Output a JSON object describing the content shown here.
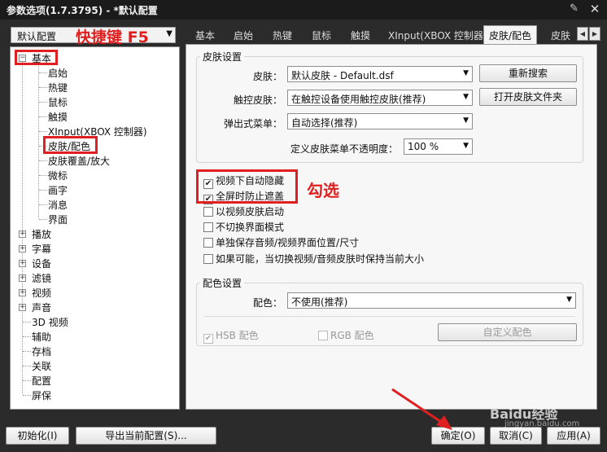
{
  "window": {
    "title": "参数选项(1.7.3795) - *默认配置",
    "pin_icon": "pin-icon",
    "close_icon": "close-icon"
  },
  "profile": {
    "value": "默认配置"
  },
  "annotations": {
    "hotkey": "快捷键 F5",
    "check": "勾选",
    "color": "#e02020"
  },
  "tabs": [
    {
      "label": "基本"
    },
    {
      "label": "启始"
    },
    {
      "label": "热键"
    },
    {
      "label": "鼠标"
    },
    {
      "label": "触摸"
    },
    {
      "label": "XInput(XBOX 控制器)"
    },
    {
      "label": "皮肤/配色"
    },
    {
      "label": "皮肤"
    }
  ],
  "active_tab": "皮肤/配色",
  "tree": {
    "root": "基本",
    "children": [
      "启始",
      "热键",
      "鼠标",
      "触摸",
      "XInput(XBOX 控制器)",
      "皮肤/配色",
      "皮肤覆盖/放大",
      "微标",
      "画字",
      "消息",
      "界面"
    ],
    "others": [
      "播放",
      "字幕",
      "设备",
      "滤镜",
      "视频",
      "声音",
      "3D 视频",
      "辅助",
      "存档",
      "关联",
      "配置",
      "屏保"
    ]
  },
  "skin_group": {
    "title": "皮肤设置",
    "skin_label": "皮肤：",
    "skin_value": "默认皮肤 - Default.dsf",
    "research_btn": "重新搜索",
    "touch_label": "触控皮肤：",
    "touch_value": "在触控设备使用触控皮肤(推荐)",
    "open_folder_btn": "打开皮肤文件夹",
    "popup_label": "弹出式菜单：",
    "popup_value": "自动选择(推荐)",
    "opacity_label": "定义皮肤菜单不透明度：",
    "opacity_value": "100 %"
  },
  "checkboxes": [
    {
      "label": "视频下自动隐藏",
      "checked": true
    },
    {
      "label": "全屏时防止遮盖",
      "checked": true
    },
    {
      "label": "以视频皮肤启动",
      "checked": false
    },
    {
      "label": "不切换界面模式",
      "checked": false
    },
    {
      "label": "单独保存音频/视频界面位置/尺寸",
      "checked": false
    },
    {
      "label": "如果可能，当切换视频/音频皮肤时保持当前大小",
      "checked": false
    }
  ],
  "color_group": {
    "title": "配色设置",
    "color_label": "配色：",
    "color_value": "不使用(推荐)",
    "hsb": "HSB 配色",
    "rgb": "RGB 配色",
    "custom_btn": "自定义配色"
  },
  "bottom": {
    "init": "初始化(I)",
    "export": "导出当前配置(S)...",
    "ok": "确定(O)",
    "cancel": "取消(C)",
    "apply": "应用(A)"
  },
  "watermark": {
    "text": "Baidu经验",
    "sub": "jingyan.baidu.com"
  }
}
